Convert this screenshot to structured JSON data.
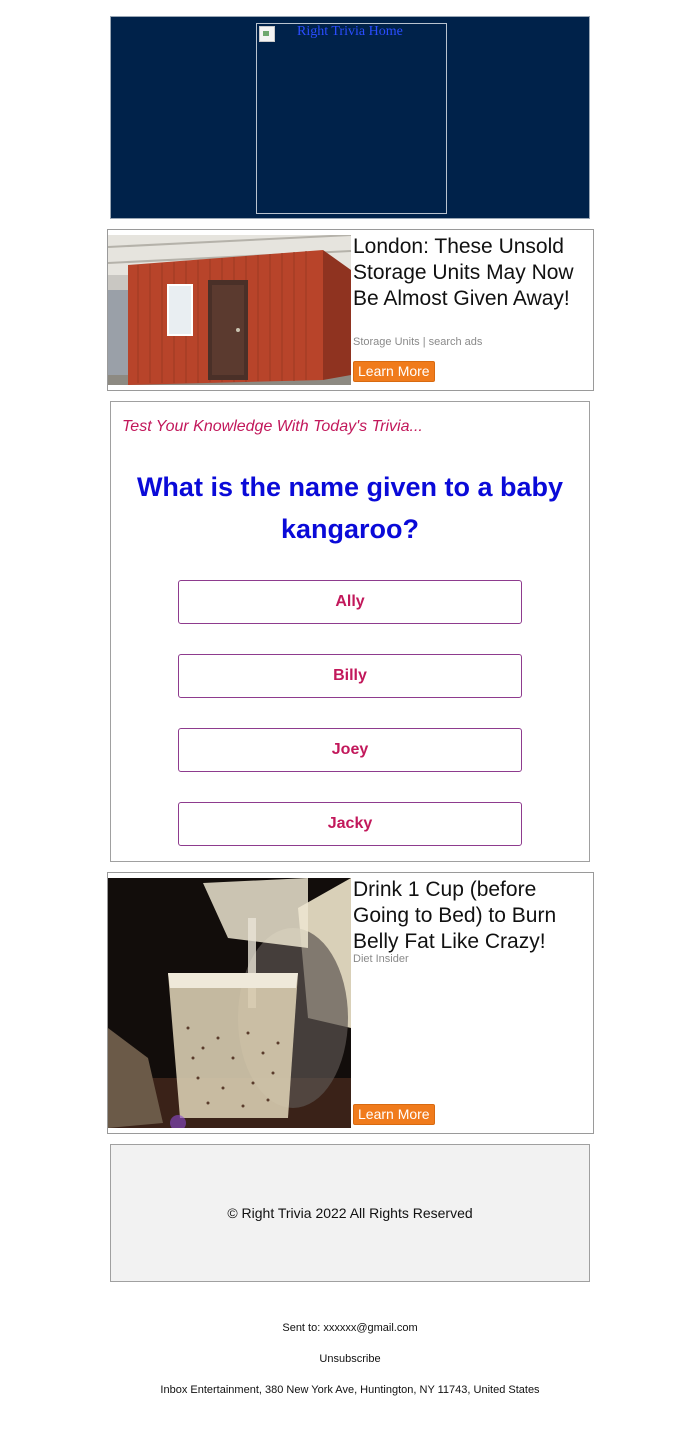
{
  "header": {
    "logo_alt": "Right Trivia Home",
    "background_color": "#00224a"
  },
  "ad_top": {
    "title": "London: These Unsold Storage Units May Now Be Almost Given Away!",
    "sponsor": "Storage Units | search ads",
    "cta": "Learn More",
    "cta_color": "#f07b1c"
  },
  "quiz": {
    "intro": "Test Your Knowledge With Today's Trivia...",
    "question": "What is the name given to a baby kangaroo?",
    "answers": [
      "Ally",
      "Billy",
      "Joey",
      "Jacky"
    ],
    "question_color": "#0a0ad8",
    "accent_color": "#c2185b"
  },
  "ad_bottom": {
    "title": "Drink 1 Cup (before Going to Bed) to Burn Belly Fat Like Crazy!",
    "sponsor": "Diet Insider",
    "cta": "Learn More"
  },
  "footer": {
    "copyright": "© Right Trivia 2022 All Rights Reserved",
    "sent_to": "Sent to: xxxxxx@gmail.com",
    "unsubscribe": "Unsubscribe",
    "address": "Inbox Entertainment, 380 New York Ave, Huntington, NY 11743, United States"
  }
}
